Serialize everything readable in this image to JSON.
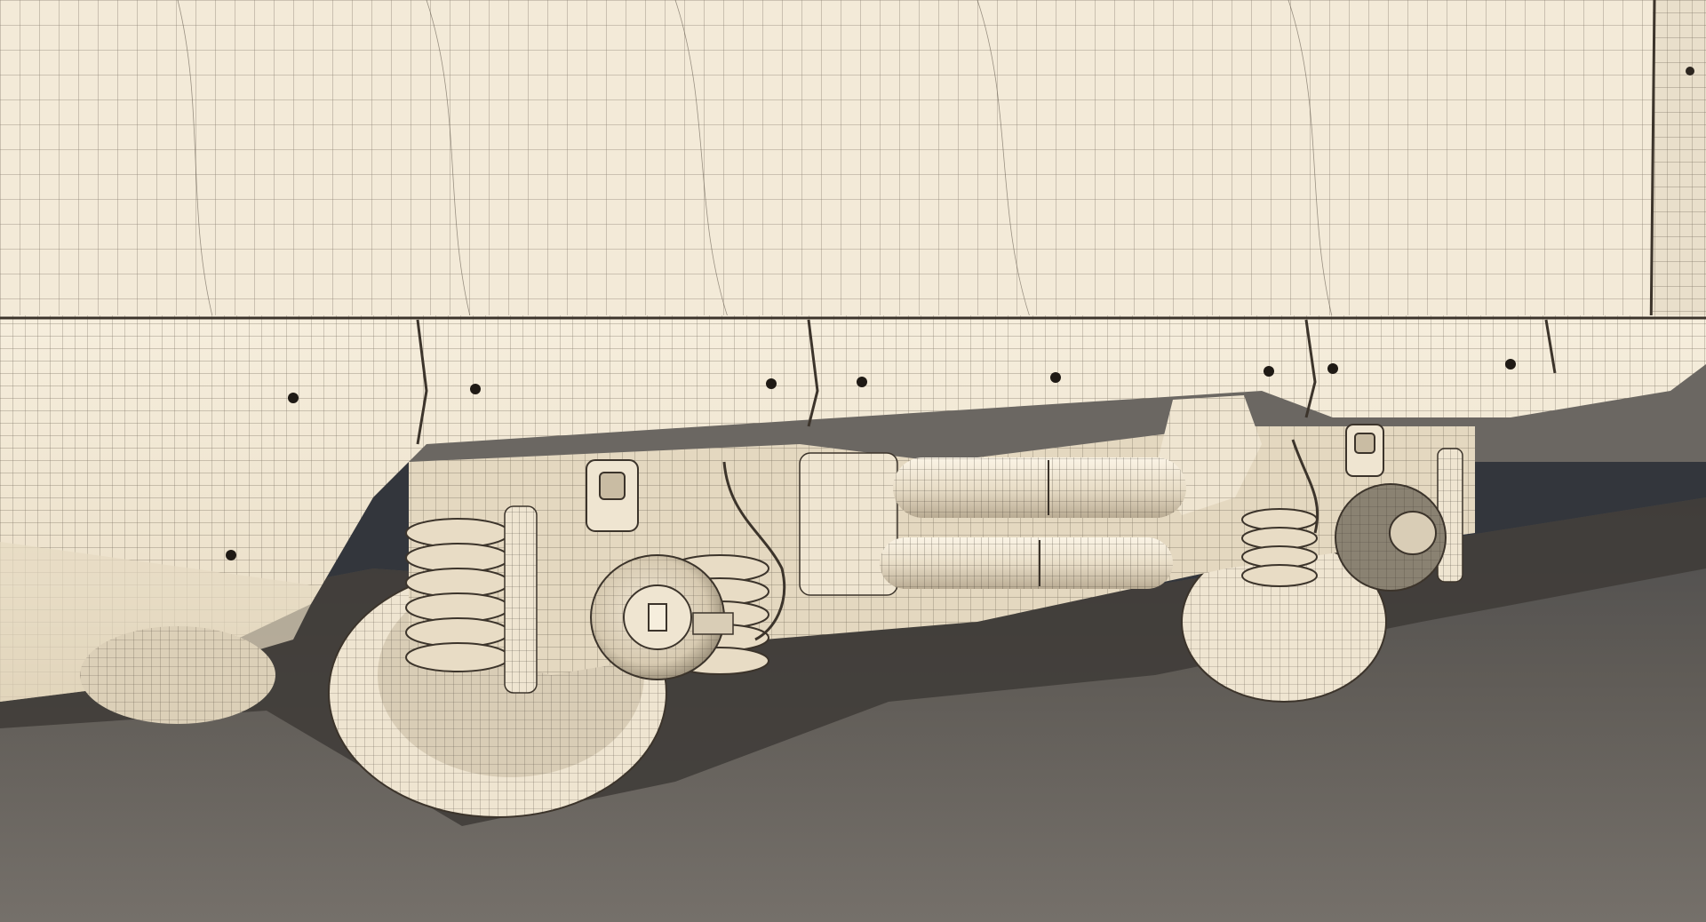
{
  "scene": {
    "subject": "train-bogie-wireframe-render",
    "colors": {
      "body": "#f3ead8",
      "body_shade": "#e2d5bd",
      "mesh": "#5e5447",
      "mesh_dark": "#3c342b",
      "ground": "#6b6762",
      "ground_dark": "#565049",
      "shadow": "#3e3b37",
      "sky_shadow": "#2e3a48",
      "metal": "#d9cdb6",
      "metal_dark": "#8a7f6e"
    }
  }
}
